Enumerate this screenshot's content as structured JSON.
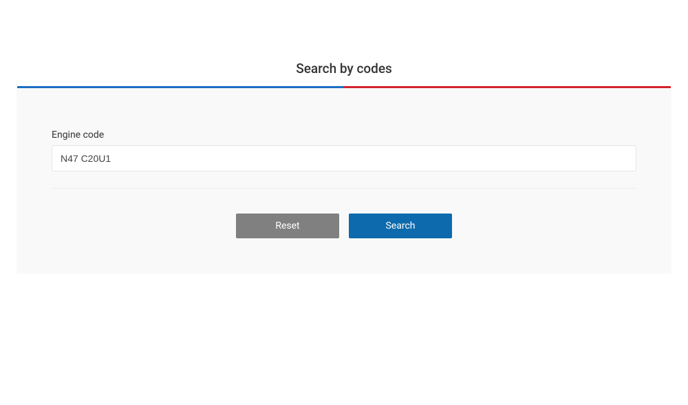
{
  "page": {
    "title": "Search by codes"
  },
  "form": {
    "engine_code": {
      "label": "Engine code",
      "value": "N47 C20U1"
    }
  },
  "buttons": {
    "reset_label": "Reset",
    "search_label": "Search"
  }
}
